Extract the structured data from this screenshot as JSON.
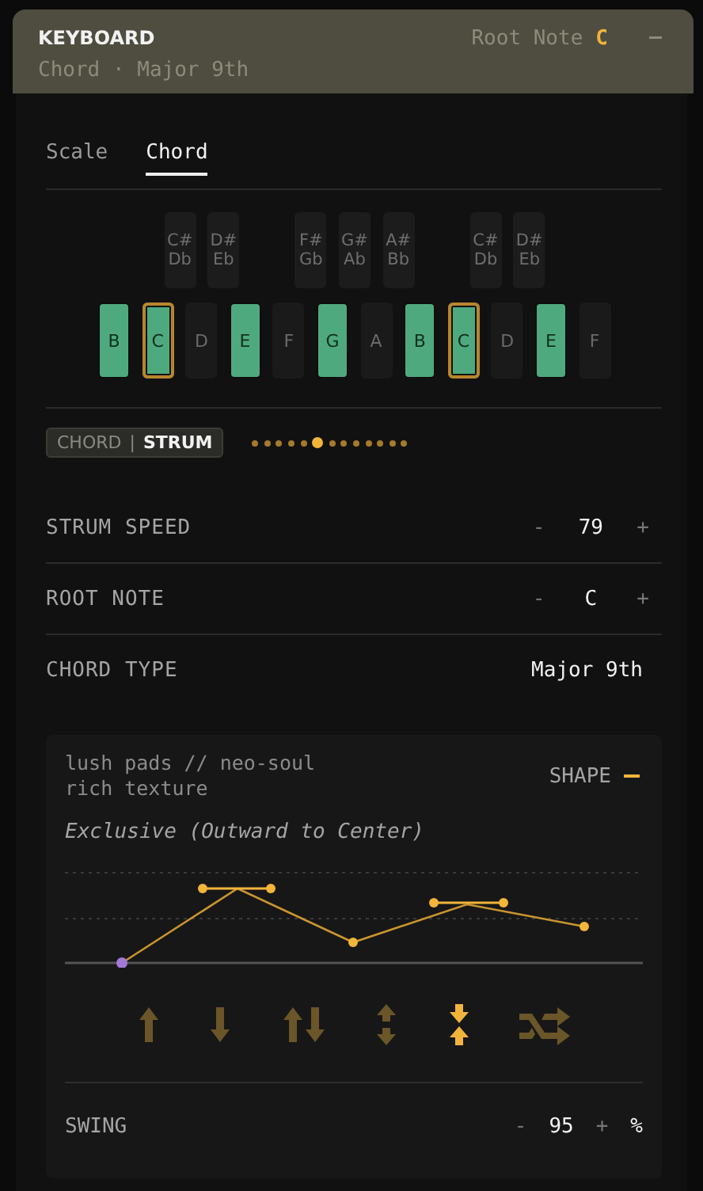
{
  "header": {
    "title": "KEYBOARD",
    "root_label": "Root Note",
    "root_value": "C",
    "subtitle": "Chord · Major 9th"
  },
  "tabs": [
    {
      "label": "Scale",
      "selected": false
    },
    {
      "label": "Chord",
      "selected": true
    }
  ],
  "keys": [
    {
      "label": "B",
      "active": true,
      "root": false
    },
    {
      "label": "C",
      "active": true,
      "root": true,
      "sharp": {
        "label": "C#",
        "alt": "Db"
      }
    },
    {
      "label": "D",
      "active": false,
      "root": false,
      "sharp": {
        "label": "D#",
        "alt": "Eb"
      }
    },
    {
      "label": "E",
      "active": true,
      "root": false
    },
    {
      "label": "F",
      "active": false,
      "root": false,
      "sharp": {
        "label": "F#",
        "alt": "Gb"
      }
    },
    {
      "label": "G",
      "active": true,
      "root": false,
      "sharp": {
        "label": "G#",
        "alt": "Ab"
      }
    },
    {
      "label": "A",
      "active": false,
      "root": false,
      "sharp": {
        "label": "A#",
        "alt": "Bb"
      }
    },
    {
      "label": "B",
      "active": true,
      "root": false
    },
    {
      "label": "C",
      "active": true,
      "root": true,
      "sharp": {
        "label": "C#",
        "alt": "Db"
      }
    },
    {
      "label": "D",
      "active": false,
      "root": false,
      "sharp": {
        "label": "D#",
        "alt": "Eb"
      }
    },
    {
      "label": "E",
      "active": true,
      "root": false
    },
    {
      "label": "F",
      "active": false,
      "root": false
    }
  ],
  "mode": {
    "separator": "|",
    "options": [
      {
        "label": "CHORD",
        "selected": false
      },
      {
        "label": "STRUM",
        "selected": true
      }
    ]
  },
  "steps": [
    {
      "selected": false
    },
    {
      "selected": false
    },
    {
      "selected": false
    },
    {
      "selected": false
    },
    {
      "selected": false
    },
    {
      "selected": true
    },
    {
      "selected": false
    },
    {
      "selected": false
    },
    {
      "selected": false
    },
    {
      "selected": false
    },
    {
      "selected": false
    },
    {
      "selected": false
    },
    {
      "selected": false
    }
  ],
  "params": [
    {
      "label": "STRUM SPEED",
      "kind": "stepper",
      "minus": "-",
      "value": "79",
      "plus": "+"
    },
    {
      "label": "ROOT NOTE",
      "kind": "stepper",
      "minus": "-",
      "value": "C",
      "plus": "+"
    },
    {
      "label": "CHORD TYPE",
      "kind": "choice",
      "value": "Major 9th"
    }
  ],
  "shape": {
    "description": [
      "lush pads // neo-soul",
      "rich texture"
    ],
    "label": "SHAPE",
    "mode_name": "Exclusive (Outward to Center)",
    "patterns": [
      {
        "kind": "up",
        "selected": false
      },
      {
        "kind": "down",
        "selected": false
      },
      {
        "kind": "up-down",
        "selected": false
      },
      {
        "kind": "outward",
        "selected": false
      },
      {
        "kind": "inward",
        "selected": true
      },
      {
        "kind": "random",
        "selected": false
      }
    ],
    "swing": {
      "label": "SWING",
      "minus": "-",
      "value": "95",
      "plus": "+",
      "unit": "%"
    }
  }
}
